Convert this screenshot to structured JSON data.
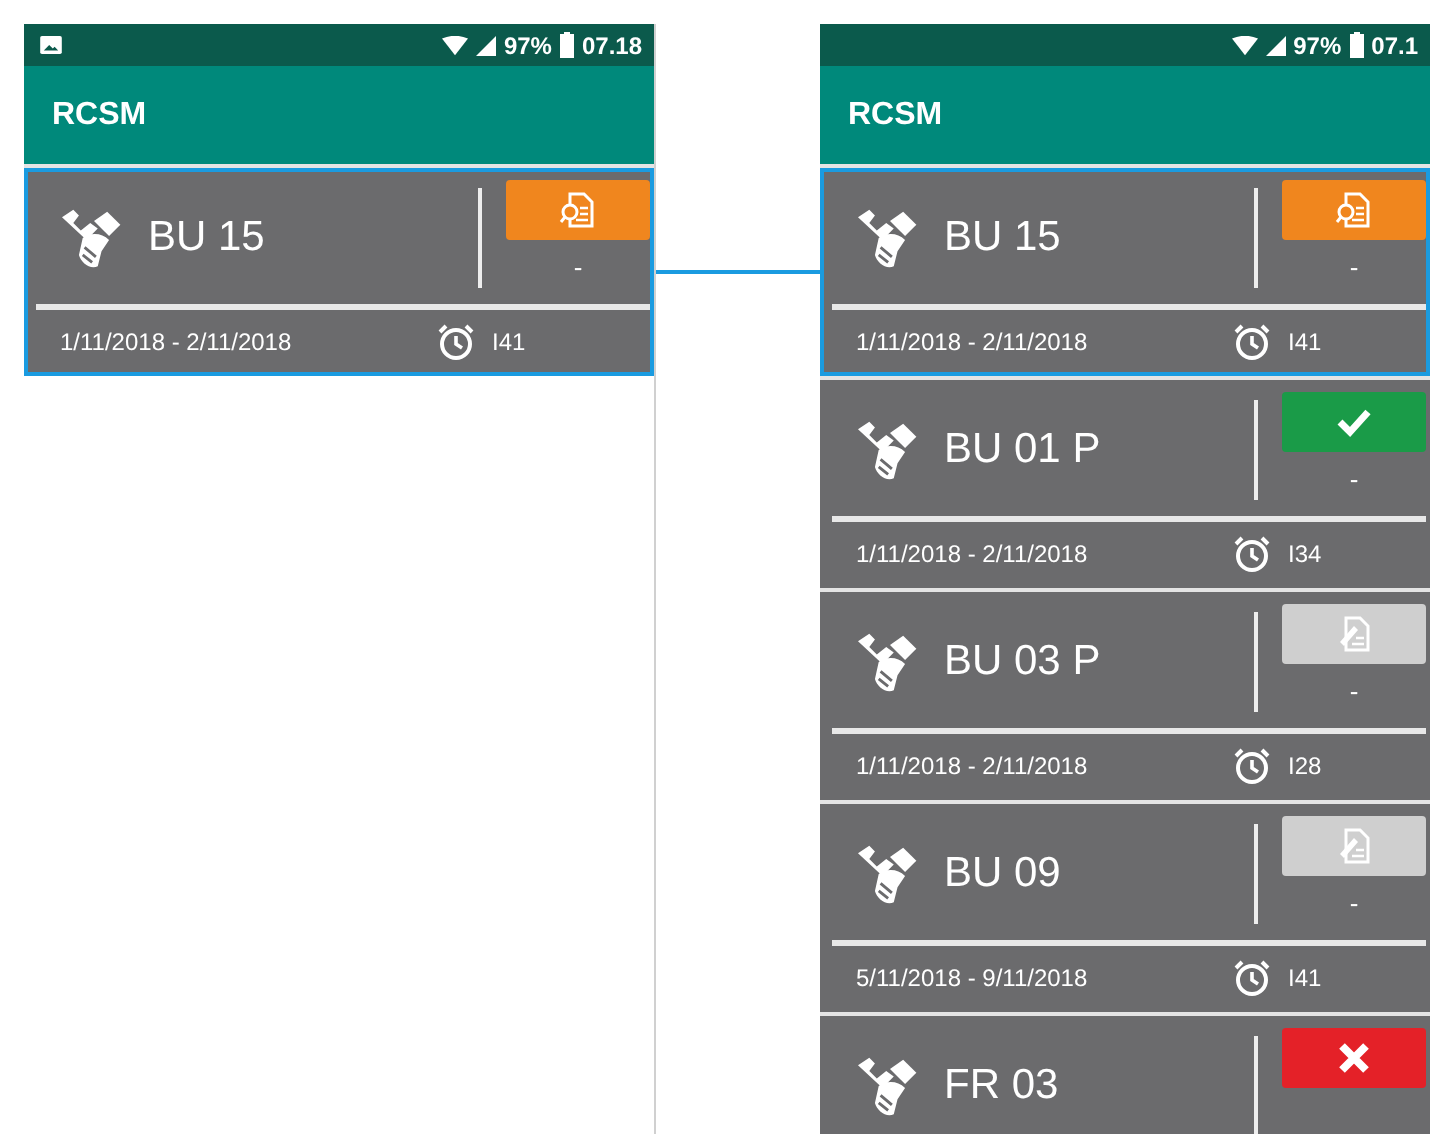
{
  "phones": [
    {
      "status_bar": {
        "notification_icon": true,
        "battery": "97%",
        "time": "07.18"
      },
      "app_bar": {
        "title": "RCSM"
      },
      "cards": [
        {
          "name": "BU 15",
          "kind": "review",
          "value": "-",
          "dates": "1/11/2018 - 2/11/2018",
          "code": "I41",
          "selected": true
        }
      ]
    },
    {
      "status_bar": {
        "notification_icon": false,
        "battery": "97%",
        "time": "07.1"
      },
      "app_bar": {
        "title": "RCSM"
      },
      "cards": [
        {
          "name": "BU 15",
          "kind": "review",
          "value": "-",
          "dates": "1/11/2018 - 2/11/2018",
          "code": "I41",
          "selected": true
        },
        {
          "name": "BU 01 P",
          "kind": "done",
          "value": "-",
          "dates": "1/11/2018 - 2/11/2018",
          "code": "I34",
          "selected": false
        },
        {
          "name": "BU 03 P",
          "kind": "pending",
          "value": "-",
          "dates": "1/11/2018 - 2/11/2018",
          "code": "I28",
          "selected": false
        },
        {
          "name": "BU 09",
          "kind": "pending",
          "value": "-",
          "dates": "5/11/2018 - 9/11/2018",
          "code": "I41",
          "selected": false
        },
        {
          "name": "FR 03",
          "kind": "rejected",
          "selected": false
        }
      ]
    }
  ]
}
